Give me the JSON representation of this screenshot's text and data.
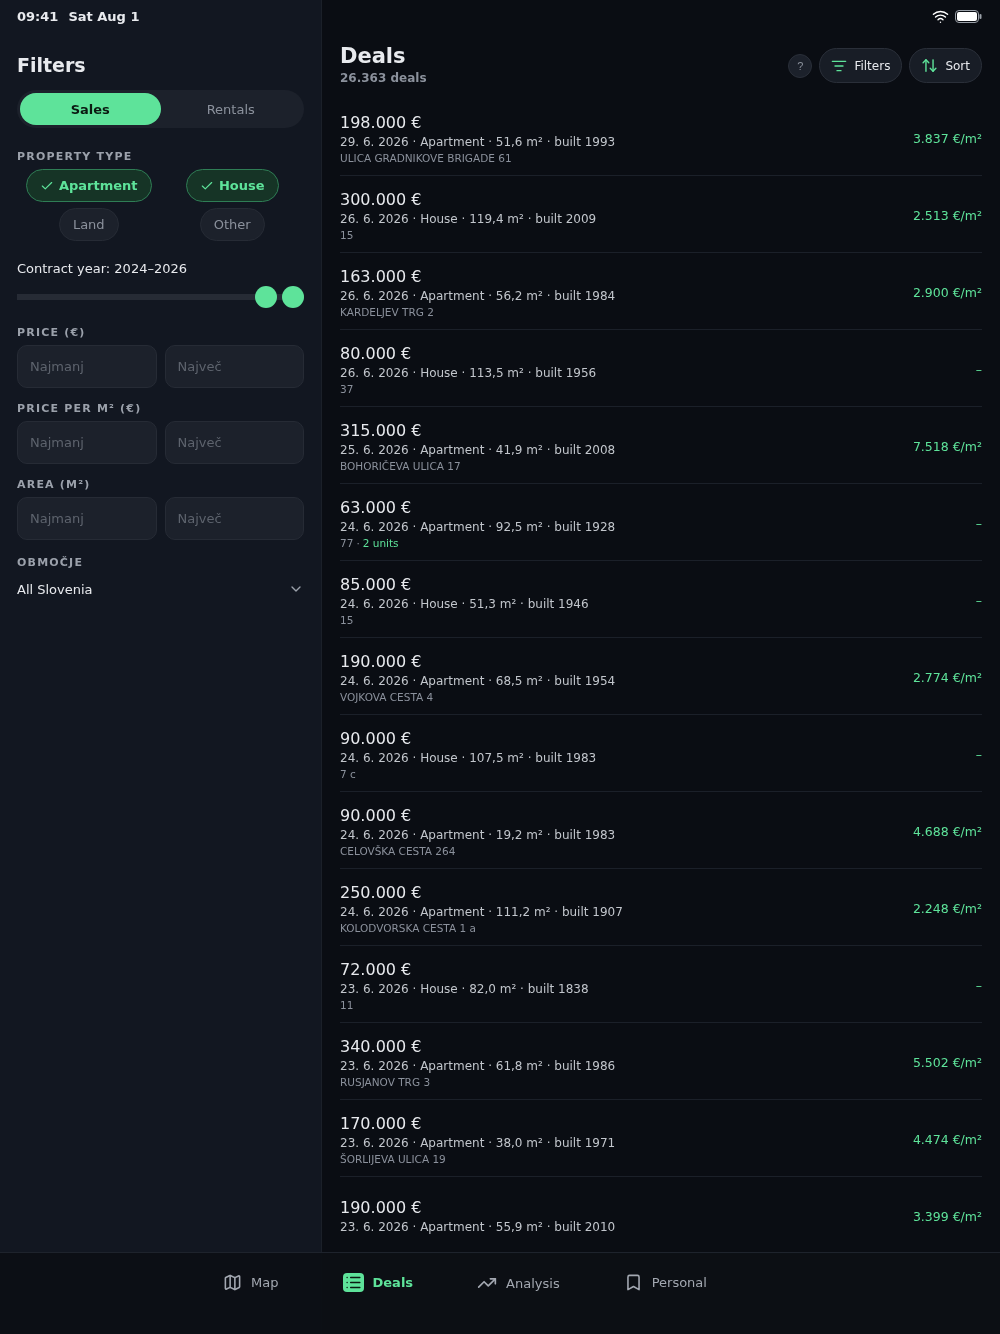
{
  "status_bar": {
    "time": "09:41",
    "date": "Sat Aug 1"
  },
  "filters": {
    "title": "Filters",
    "segments": [
      {
        "label": "Sales",
        "selected": true
      },
      {
        "label": "Rentals",
        "selected": false
      }
    ],
    "property_type": {
      "label": "PROPERTY TYPE",
      "chips": [
        {
          "label": "Apartment",
          "checked": true
        },
        {
          "label": "House",
          "checked": true
        },
        {
          "label": "Land",
          "checked": false
        },
        {
          "label": "Other",
          "checked": false
        }
      ]
    },
    "contract_year": {
      "label": "Contract year: 2024–2026",
      "thumbs": [
        {
          "level": 0.9
        },
        {
          "level": 1
        }
      ]
    },
    "ranges": [
      {
        "label": "PRICE (€)",
        "min_placeholder": "Najmanj",
        "max_placeholder": "Največ"
      },
      {
        "label": "PRICE PER M² (€)",
        "min_placeholder": "Najmanj",
        "max_placeholder": "Največ"
      },
      {
        "label": "AREA (M²)",
        "min_placeholder": "Najmanj",
        "max_placeholder": "Največ"
      }
    ],
    "region": {
      "label": "OBMOČJE",
      "value": "All Slovenia"
    }
  },
  "deals": {
    "title": "Deals",
    "count": "26.363 deals",
    "help": "?",
    "buttons": [
      {
        "kind": "filters",
        "label": "Filters"
      },
      {
        "kind": "sort",
        "label": "Sort"
      }
    ],
    "rows": [
      {
        "price": "198.000 €",
        "meta": "29. 6. 2026 · Apartment · 51,6 m² · built 1993",
        "sub": "ULICA GRADNIKOVE BRIGADE 61",
        "per_m2": "3.837 €/m²"
      },
      {
        "price": "300.000 €",
        "meta": "26. 6. 2026 · House · 119,4 m² · built 2009",
        "sub": "15",
        "per_m2": "2.513 €/m²"
      },
      {
        "price": "163.000 €",
        "meta": "26. 6. 2026 · Apartment · 56,2 m² · built 1984",
        "sub": "KARDELJEV TRG 2",
        "per_m2": "2.900 €/m²"
      },
      {
        "price": "80.000 €",
        "meta": "26. 6. 2026 · House · 113,5 m² · built 1956",
        "sub": "37",
        "per_m2": "–"
      },
      {
        "price": "315.000 €",
        "meta": "25. 6. 2026 · Apartment · 41,9 m² · built 2008",
        "sub": "BOHORIČEVA ULICA 17",
        "per_m2": "7.518 €/m²"
      },
      {
        "price": "63.000 €",
        "meta": "24. 6. 2026 · Apartment · 92,5 m² · built 1928",
        "sub": "77",
        "sep": "·",
        "units": "2 units",
        "per_m2": "–"
      },
      {
        "price": "85.000 €",
        "meta": "24. 6. 2026 · House · 51,3 m² · built 1946",
        "sub": "15",
        "per_m2": "–"
      },
      {
        "price": "190.000 €",
        "meta": "24. 6. 2026 · Apartment · 68,5 m² · built 1954",
        "sub": "VOJKOVA CESTA 4",
        "per_m2": "2.774 €/m²"
      },
      {
        "price": "90.000 €",
        "meta": "24. 6. 2026 · House · 107,5 m² · built 1983",
        "sub": "7 c",
        "per_m2": "–"
      },
      {
        "price": "90.000 €",
        "meta": "24. 6. 2026 · Apartment · 19,2 m² · built 1983",
        "sub": "CELOVŠKA CESTA 264",
        "per_m2": "4.688 €/m²"
      },
      {
        "price": "250.000 €",
        "meta": "24. 6. 2026 · Apartment · 111,2 m² · built 1907",
        "sub": "KOLODVORSKA CESTA 1 a",
        "per_m2": "2.248 €/m²"
      },
      {
        "price": "72.000 €",
        "meta": "23. 6. 2026 · House · 82,0 m² · built 1838",
        "sub": "11",
        "per_m2": "–"
      },
      {
        "price": "340.000 €",
        "meta": "23. 6. 2026 · Apartment · 61,8 m² · built 1986",
        "sub": "RUSJANOV TRG 3",
        "per_m2": "5.502 €/m²"
      },
      {
        "price": "170.000 €",
        "meta": "23. 6. 2026 · Apartment · 38,0 m² · built 1971",
        "sub": "ŠORLIJEVA ULICA 19",
        "per_m2": "4.474 €/m²"
      },
      {
        "price": "190.000 €",
        "meta": "23. 6. 2026 · Apartment · 55,9 m² · built 2010",
        "per_m2": "3.399 €/m²"
      }
    ]
  },
  "tab_bar": [
    {
      "kind": "map",
      "label": "Map",
      "selected": false
    },
    {
      "kind": "deals",
      "label": "Deals",
      "selected": true
    },
    {
      "kind": "analysis",
      "label": "Analysis",
      "selected": false
    },
    {
      "kind": "personal",
      "label": "Personal",
      "selected": false
    }
  ]
}
